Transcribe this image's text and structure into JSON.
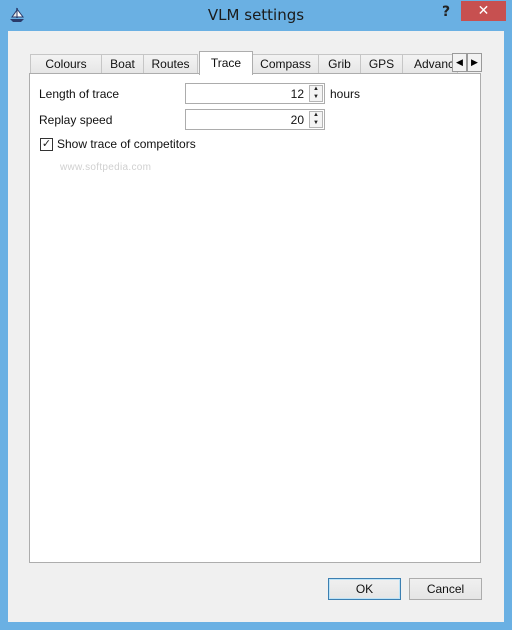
{
  "window": {
    "title": "VLM settings",
    "help_label": "?",
    "close_label": "✕",
    "app_icon": "boat-icon"
  },
  "tabs": [
    {
      "label": "Colours",
      "active": false
    },
    {
      "label": "Boat",
      "active": false
    },
    {
      "label": "Routes",
      "active": false
    },
    {
      "label": "Trace",
      "active": true
    },
    {
      "label": "Compass",
      "active": false
    },
    {
      "label": "Grib",
      "active": false
    },
    {
      "label": "GPS",
      "active": false
    },
    {
      "label": "Advanc",
      "active": false
    }
  ],
  "tab_scroll": {
    "left": "◀",
    "right": "▶"
  },
  "trace": {
    "length_label": "Length of trace",
    "length_value": "12",
    "length_unit": "hours",
    "replay_label": "Replay speed",
    "replay_value": "20",
    "competitors_label": "Show trace of competitors",
    "competitors_checked": true,
    "check_mark": "✓"
  },
  "spin_arrows": {
    "up": "▲",
    "down": "▼"
  },
  "watermark": "www.softpedia.com",
  "buttons": {
    "ok": "OK",
    "cancel": "Cancel"
  },
  "colors": {
    "titlebar": "#6ab0e3",
    "close": "#c75050",
    "dialog_bg": "#f0f0f0"
  }
}
